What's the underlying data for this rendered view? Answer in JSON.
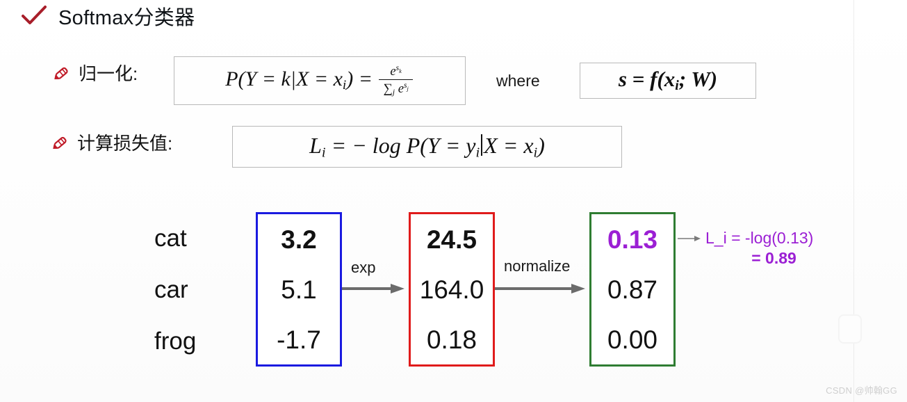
{
  "slide": {
    "title": "Softmax分类器",
    "check_icon": "check-icon",
    "colors": {
      "check_red": "#a81e2a",
      "pencil_red": "#c01b28",
      "scores_box": "#1a1ae0",
      "exp_box": "#e01b1b",
      "probs_box": "#2f7d32",
      "annotation_purple": "#9b1fd4",
      "text": "#111111"
    }
  },
  "normalization": {
    "pencil_icon": "pencil-icon",
    "label": "归一化:",
    "formula": {
      "lhs": "P(Y = k|X = x",
      "lhs_sub": "i",
      "lhs_close": ") =",
      "numerator_base": "e",
      "numerator_sup": "s",
      "numerator_sup_sub": "k",
      "denominator_sigma": "∑",
      "denominator_sigma_sub": "j",
      "denominator_base": "e",
      "denominator_sup": "s",
      "denominator_sup_sub": "j",
      "plain_text": "P(Y = k|X = x_i) = e^{s_k} / Σ_j e^{s_j}"
    },
    "where_label": "where",
    "where_formula": {
      "lhs": "s = f(x",
      "lhs_sub": "i",
      "lhs_tail": "; W)",
      "plain_text": "s = f(x_i; W)"
    }
  },
  "loss": {
    "pencil_icon": "pencil-icon",
    "label": "计算损失值:",
    "formula": {
      "head": "L",
      "head_sub": "i",
      "mid": " = − log P(Y = y",
      "mid_sub": "i",
      "tail_bar": "|",
      "tail": "X = x",
      "tail_sub": "i",
      "close": ")",
      "plain_text": "L_i = − log P(Y = y_i|X = x_i)"
    }
  },
  "diagram": {
    "class_labels": [
      "cat",
      "car",
      "frog"
    ],
    "boxes": [
      {
        "name": "scores",
        "border_color": "#1a1ae0",
        "values": [
          "3.2",
          "5.1",
          "-1.7"
        ],
        "emphasis": [
          true,
          false,
          false
        ],
        "emphasis_color": "#111111"
      },
      {
        "name": "unnormalized-probabilities",
        "border_color": "#e01b1b",
        "values": [
          "24.5",
          "164.0",
          "0.18"
        ],
        "emphasis": [
          true,
          false,
          false
        ],
        "emphasis_color": "#111111"
      },
      {
        "name": "probabilities",
        "border_color": "#2f7d32",
        "values": [
          "0.13",
          "0.87",
          "0.00"
        ],
        "emphasis": [
          true,
          false,
          false
        ],
        "emphasis_color": "#9b1fd4"
      }
    ],
    "arrows": [
      {
        "name": "exp-arrow",
        "label": "exp"
      },
      {
        "name": "normalize-arrow",
        "label": "normalize"
      },
      {
        "name": "loss-arrow",
        "label": ""
      }
    ],
    "annotation": {
      "line1": "L_i = -log(0.13)",
      "line2": "= 0.89"
    }
  },
  "watermark": "CSDN @帅翰GG"
}
